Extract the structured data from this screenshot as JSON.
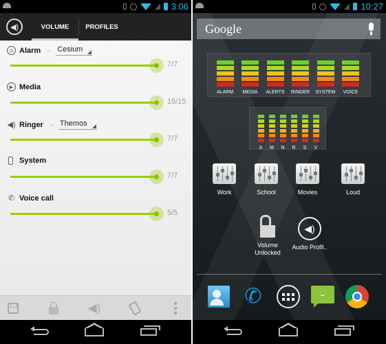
{
  "left_screen": {
    "status_bar": {
      "time": "3:06",
      "icons": [
        "android-icon",
        "bluetooth-icon",
        "alarm-icon",
        "wifi-icon",
        "signal-icon",
        "battery-icon"
      ]
    },
    "action_bar": {
      "app_icon": "speaker-icon",
      "tabs": [
        {
          "label": "VOLUME",
          "selected": true
        },
        {
          "label": "PROFILES",
          "selected": false
        }
      ]
    },
    "volume_rows": [
      {
        "icon": "alarm-clock-icon",
        "label": "Alarm",
        "profile": "Cesium",
        "value_text": "7/7",
        "level": 1.0
      },
      {
        "icon": "play-icon",
        "label": "Media",
        "profile": null,
        "value_text": "15/15",
        "level": 1.0
      },
      {
        "icon": "speaker-icon",
        "label": "Ringer",
        "profile": "Themos",
        "value_text": "7/7",
        "level": 1.0
      },
      {
        "icon": "phone-device-icon",
        "label": "System",
        "profile": null,
        "value_text": "7/7",
        "level": 1.0
      },
      {
        "icon": "phone-call-icon",
        "label": "Voice call",
        "profile": null,
        "value_text": "5/5",
        "level": 1.0
      }
    ],
    "arrow_glyph": "→",
    "bottom_bar": [
      "save-icon",
      "lock-icon",
      "vibrate-speaker-icon",
      "rotate-icon",
      "overflow-menu-icon"
    ],
    "accent_color": "#99cc00"
  },
  "right_screen": {
    "status_bar": {
      "time": "10:27"
    },
    "search": {
      "label": "Google"
    },
    "big_widget": {
      "meters": [
        {
          "label": "ALARM",
          "level": 5
        },
        {
          "label": "MEDIA",
          "level": 5
        },
        {
          "label": "ALERTS",
          "level": 5
        },
        {
          "label": "RINGER",
          "level": 5
        },
        {
          "label": "SYSTEM",
          "level": 5
        },
        {
          "label": "VOICE",
          "level": 5
        }
      ],
      "segments": 5
    },
    "small_widget": {
      "meters": [
        {
          "label": "A",
          "level": 6
        },
        {
          "label": "M",
          "level": 6
        },
        {
          "label": "N",
          "level": 6
        },
        {
          "label": "R",
          "level": 6
        },
        {
          "label": "S",
          "level": 6
        },
        {
          "label": "V",
          "level": 6
        }
      ],
      "segments": 6
    },
    "meter_colors": [
      "#6fd12a",
      "#a6dc26",
      "#f3c21a",
      "#f08a18",
      "#e2231a"
    ],
    "meter_colors_6": [
      "#6fd12a",
      "#a6dc26",
      "#d6d020",
      "#f3b01a",
      "#f08a18",
      "#e2231a"
    ],
    "profile_shortcuts": [
      "Work",
      "School",
      "Movies",
      "Loud"
    ],
    "shortcuts": [
      {
        "label": "Volume Unlocked",
        "icon": "unlocked-icon"
      },
      {
        "label": "Audio Profil..",
        "icon": "audio-profiles-icon"
      }
    ],
    "dock": [
      "people-icon",
      "phone-icon",
      "all-apps-icon",
      "messaging-icon",
      "chrome-icon"
    ],
    "message_glyph": "⌣",
    "phone_glyph": "✆",
    "speaker_glyph": "🔈"
  }
}
